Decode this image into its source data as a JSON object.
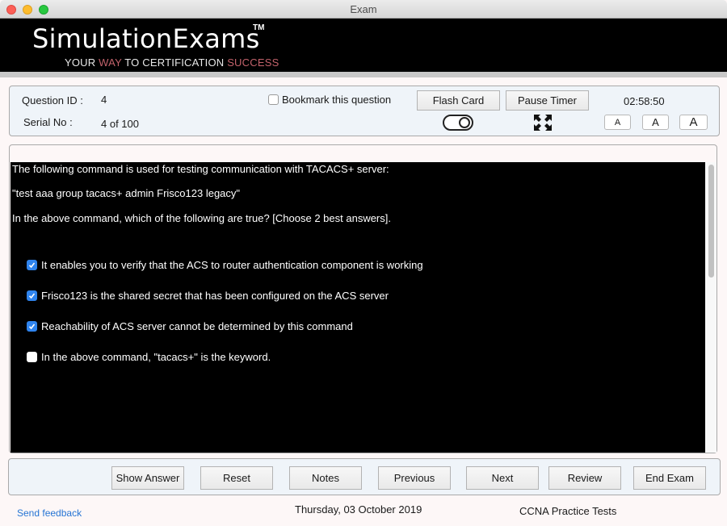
{
  "window": {
    "title": "Exam"
  },
  "banner": {
    "brand": "SimulationExams",
    "trademark": "TM",
    "tagline": {
      "part1": "YOUR ",
      "accent1": "WAY",
      "part2": " TO CERTIFICATION ",
      "accent2": "SUCCESS"
    },
    "accent_color": "#c2626b"
  },
  "info": {
    "question_id_label": "Question ID :",
    "question_id_value": "4",
    "serial_label": "Serial No :",
    "serial_value": "4 of 100",
    "bookmark_label": "Bookmark this question",
    "bookmark_checked": false,
    "flash_card_label": "Flash Card",
    "flash_card_toggle": "off",
    "pause_timer_label": "Pause Timer",
    "timer_value": "02:58:50",
    "fullscreen_icon": "expand-arrows-icon",
    "font_size_buttons": [
      "A",
      "A",
      "A"
    ]
  },
  "question": {
    "lines": [
      "The following command is used for testing communication with TACACS+ server:",
      "\"test aaa group tacacs+ admin Frisco123 legacy\"",
      "In the above command, which of the following are true? [Choose 2 best answers]."
    ],
    "options": [
      {
        "text": "It enables you to verify that the ACS to router authentication component is working",
        "checked": true
      },
      {
        "text": "Frisco123 is the shared secret that has been configured on the ACS server",
        "checked": true
      },
      {
        "text": "Reachability of ACS server cannot be determined by this command",
        "checked": true
      },
      {
        "text": "In the above command, \"tacacs+\" is the keyword.",
        "checked": false
      }
    ],
    "checkbox_color": "#2f84ee"
  },
  "nav": {
    "show_answer": "Show Answer",
    "reset": "Reset",
    "notes": "Notes",
    "previous": "Previous",
    "next": "Next",
    "review": "Review",
    "end_exam": "End Exam"
  },
  "footer": {
    "feedback_link": "Send feedback",
    "date": "Thursday, 03 October 2019",
    "product": "CCNA Practice Tests",
    "link_color": "#2574d4"
  }
}
